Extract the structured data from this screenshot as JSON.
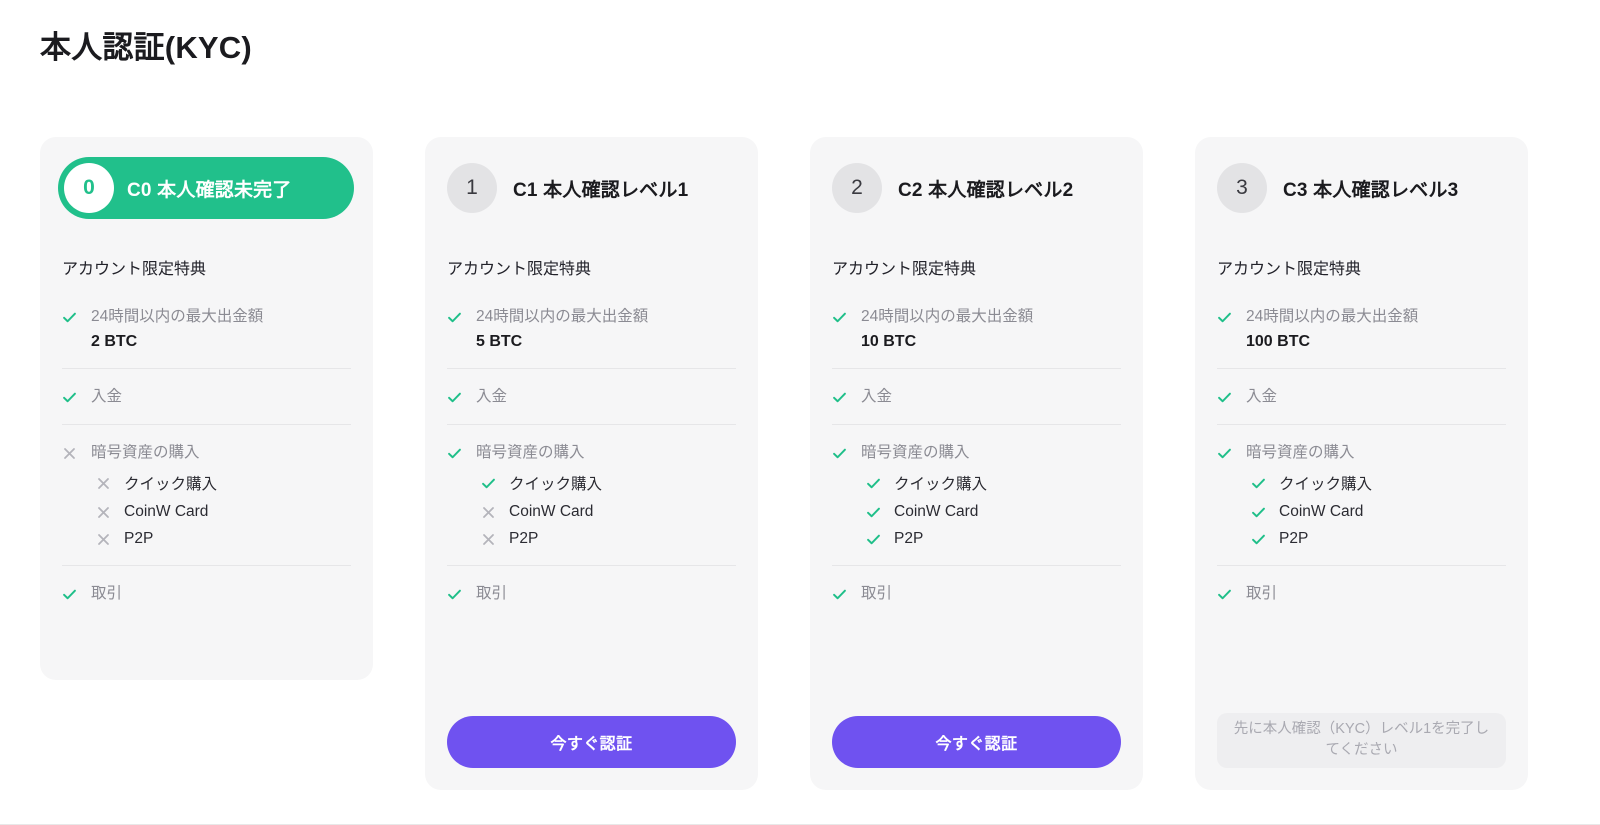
{
  "page": {
    "title": "本人認証(KYC)"
  },
  "colors": {
    "accent_green": "#21c08b",
    "accent_purple": "#6f52f0",
    "card_bg": "#f6f6f7",
    "badge_bg": "#e3e3e5",
    "muted_text": "#8b8b93"
  },
  "labels": {
    "benefits_title": "アカウント限定特典",
    "check_icon": "check-icon",
    "cross_icon": "cross-icon"
  },
  "cards": [
    {
      "badge": "0",
      "title": "C0 本人確認未完了",
      "active": true,
      "benefits_title": "アカウント限定特典",
      "rows": [
        {
          "status": "check",
          "label": "24時間以内の最大出金額",
          "value": "2 BTC",
          "subs": []
        },
        {
          "status": "check",
          "label": "入金",
          "value": null,
          "subs": []
        },
        {
          "status": "cross",
          "label": "暗号資産の購入",
          "value": null,
          "subs": [
            {
              "status": "cross",
              "label": "クイック購入"
            },
            {
              "status": "cross",
              "label": "CoinW Card"
            },
            {
              "status": "cross",
              "label": "P2P"
            }
          ]
        },
        {
          "status": "check",
          "label": "取引",
          "value": null,
          "subs": []
        }
      ],
      "footer": null
    },
    {
      "badge": "1",
      "title": "C1 本人確認レベル1",
      "active": false,
      "benefits_title": "アカウント限定特典",
      "rows": [
        {
          "status": "check",
          "label": "24時間以内の最大出金額",
          "value": "5 BTC",
          "subs": []
        },
        {
          "status": "check",
          "label": "入金",
          "value": null,
          "subs": []
        },
        {
          "status": "check",
          "label": "暗号資産の購入",
          "value": null,
          "subs": [
            {
              "status": "check",
              "label": "クイック購入"
            },
            {
              "status": "cross",
              "label": "CoinW Card"
            },
            {
              "status": "cross",
              "label": "P2P"
            }
          ]
        },
        {
          "status": "check",
          "label": "取引",
          "value": null,
          "subs": []
        }
      ],
      "footer": {
        "type": "button",
        "label": "今すぐ認証"
      }
    },
    {
      "badge": "2",
      "title": "C2 本人確認レベル2",
      "active": false,
      "benefits_title": "アカウント限定特典",
      "rows": [
        {
          "status": "check",
          "label": "24時間以内の最大出金額",
          "value": "10 BTC",
          "subs": []
        },
        {
          "status": "check",
          "label": "入金",
          "value": null,
          "subs": []
        },
        {
          "status": "check",
          "label": "暗号資産の購入",
          "value": null,
          "subs": [
            {
              "status": "check",
              "label": "クイック購入"
            },
            {
              "status": "check",
              "label": "CoinW Card"
            },
            {
              "status": "check",
              "label": "P2P"
            }
          ]
        },
        {
          "status": "check",
          "label": "取引",
          "value": null,
          "subs": []
        }
      ],
      "footer": {
        "type": "button",
        "label": "今すぐ認証"
      }
    },
    {
      "badge": "3",
      "title": "C3 本人確認レベル3",
      "active": false,
      "benefits_title": "アカウント限定特典",
      "rows": [
        {
          "status": "check",
          "label": "24時間以内の最大出金額",
          "value": "100 BTC",
          "subs": []
        },
        {
          "status": "check",
          "label": "入金",
          "value": null,
          "subs": []
        },
        {
          "status": "check",
          "label": "暗号資産の購入",
          "value": null,
          "subs": [
            {
              "status": "check",
              "label": "クイック購入"
            },
            {
              "status": "check",
              "label": "CoinW Card"
            },
            {
              "status": "check",
              "label": "P2P"
            }
          ]
        },
        {
          "status": "check",
          "label": "取引",
          "value": null,
          "subs": []
        }
      ],
      "footer": {
        "type": "disabled",
        "label": "先に本人確認（KYC）レベル1を完了してください"
      }
    }
  ]
}
